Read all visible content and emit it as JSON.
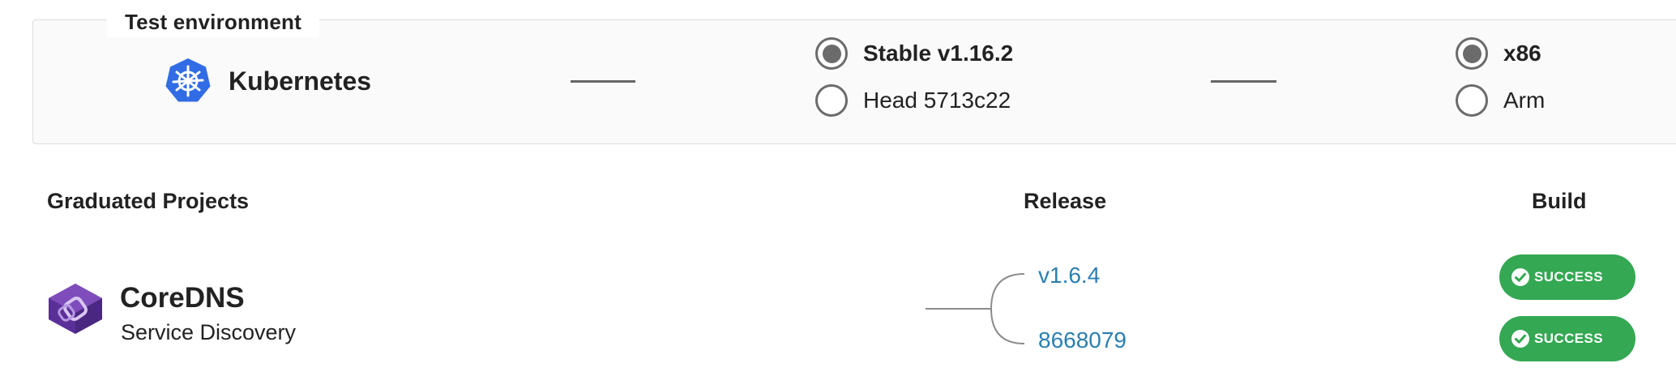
{
  "environment": {
    "legend": "Test environment",
    "platform": {
      "name": "Kubernetes",
      "icon": "kubernetes-helm-icon",
      "icon_color": "#326ce5"
    },
    "versions": [
      {
        "label": "Stable v1.16.2",
        "selected": true
      },
      {
        "label": "Head 5713c22",
        "selected": false
      }
    ],
    "architectures": [
      {
        "label": "x86",
        "selected": true
      },
      {
        "label": "Arm",
        "selected": false
      }
    ]
  },
  "table": {
    "headers": {
      "projects": "Graduated Projects",
      "release": "Release",
      "build": "Build"
    },
    "rows": [
      {
        "name": "CoreDNS",
        "category": "Service Discovery",
        "logo": "coredns-logo",
        "logo_color": "#6b3fa0",
        "releases": [
          {
            "label": "v1.6.4"
          },
          {
            "label": "8668079"
          }
        ],
        "builds": [
          {
            "label": "SUCCESS",
            "status": "success"
          },
          {
            "label": "SUCCESS",
            "status": "success"
          }
        ]
      }
    ]
  },
  "colors": {
    "link": "#2a7fb0",
    "success": "#34a853",
    "radio": "#6b6b6b"
  }
}
